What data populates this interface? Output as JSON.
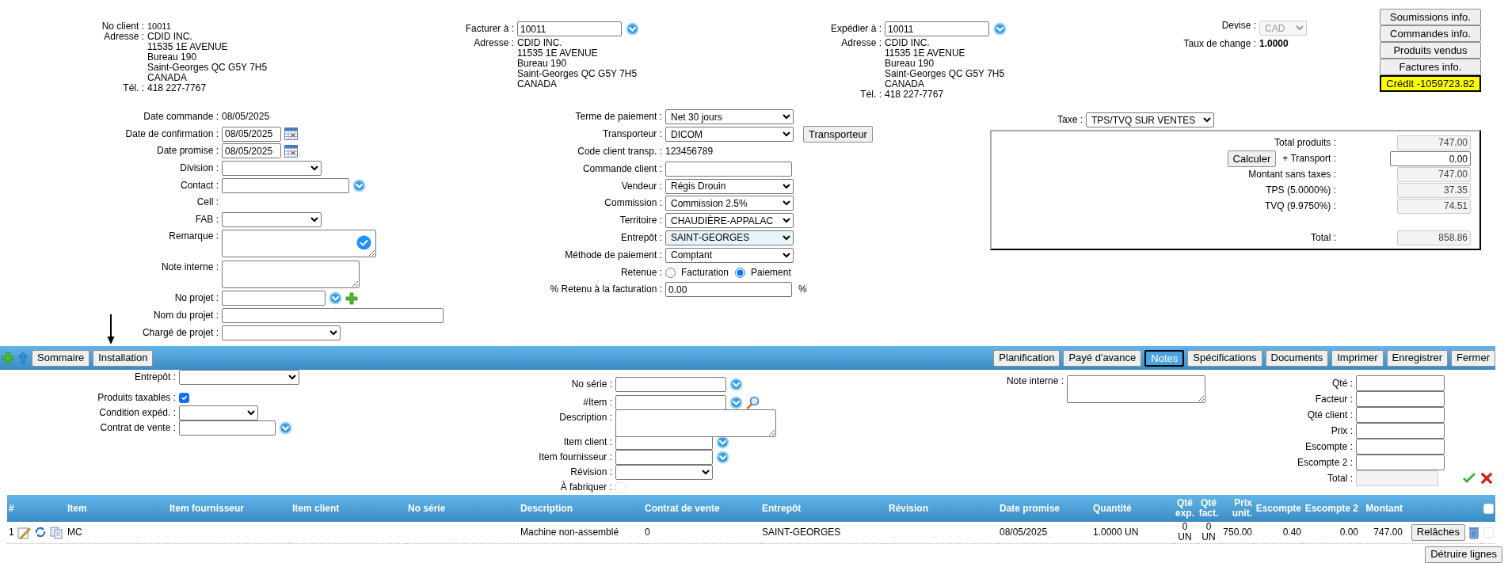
{
  "client": {
    "label": "No client :",
    "value": "10011",
    "address_label": "Adresse :",
    "address_lines": [
      "CDID INC.",
      "11535 1E AVENUE",
      "Bureau 190",
      "Saint-Georges QC G5Y 7H5",
      "CANADA"
    ],
    "phone_label": "Tél. :",
    "phone": "418 227-7767"
  },
  "bill_to": {
    "label": "Facturer à :",
    "value": "10011",
    "address_label": "Adresse :",
    "address_lines": [
      "CDID INC.",
      "11535 1E AVENUE",
      "Bureau 190",
      "Saint-Georges QC G5Y 7H5",
      "CANADA"
    ]
  },
  "ship_to": {
    "label": "Expédier à :",
    "value": "10011",
    "address_label": "Adresse :",
    "address_lines": [
      "CDID INC.",
      "11535 1E AVENUE",
      "Bureau 190",
      "Saint-Georges QC G5Y 7H5",
      "CANADA"
    ],
    "phone_label": "Tél. :",
    "phone": "418 227-7767"
  },
  "currency": {
    "label": "Devise :",
    "value": "CAD",
    "disabled": true,
    "rate_label": "Taux de change :",
    "rate": "1.0000"
  },
  "info_buttons": [
    {
      "label": "Soumissions info.",
      "kind": "button"
    },
    {
      "label": "Commandes info.",
      "kind": "button"
    },
    {
      "label": "Produits vendus",
      "kind": "button"
    },
    {
      "label": "Factures info.",
      "kind": "button"
    },
    {
      "label": "Crédit -1059723.82",
      "kind": "credit"
    }
  ],
  "order_left": [
    {
      "kind": "text",
      "label": "Date commande :",
      "value": "08/05/2025"
    },
    {
      "kind": "date",
      "label": "Date de confirmation :",
      "value": "08/05/2025"
    },
    {
      "kind": "date",
      "label": "Date promise :",
      "value": "08/05/2025"
    },
    {
      "kind": "select",
      "label": "Division :"
    },
    {
      "kind": "lookup",
      "label": "Contact :"
    },
    {
      "kind": "text",
      "label": "Cell :"
    },
    {
      "kind": "select",
      "label": "FAB :"
    },
    {
      "kind": "textarea",
      "label": "Remarque :",
      "assistant": true
    },
    {
      "kind": "textarea",
      "label": "Note interne :",
      "assistant": false
    },
    {
      "kind": "lookup_add",
      "label": "No projet :"
    },
    {
      "kind": "wide_input",
      "label": "Nom du projet :"
    },
    {
      "kind": "select",
      "label": "Chargé de projet :"
    }
  ],
  "order_middle": [
    {
      "kind": "select",
      "label": "Terme de paiement :",
      "value": "Net 30 jours",
      "highlighted": false
    },
    {
      "kind": "select_button",
      "label": "Transporteur :",
      "value": "DICOM",
      "button": "Transporteur"
    },
    {
      "kind": "text",
      "label": "Code client transp. :",
      "value": "123456789"
    },
    {
      "kind": "input",
      "label": "Commande client :"
    },
    {
      "kind": "select",
      "label": "Vendeur :",
      "value": "Régis Drouin",
      "highlighted": false
    },
    {
      "kind": "select",
      "label": "Commission :",
      "value": "Commission 2.5%",
      "highlighted": false
    },
    {
      "kind": "select",
      "label": "Territoire :",
      "value": "CHAUDIÈRE-APPALAC",
      "highlighted": false
    },
    {
      "kind": "select",
      "label": "Entrepôt :",
      "value": "SAINT-GEORGES",
      "highlighted": true
    },
    {
      "kind": "select",
      "label": "Méthode de paiement :",
      "value": "Comptant",
      "highlighted": false
    },
    {
      "kind": "radio",
      "label": "Retenue :",
      "options": [
        {
          "label": "Facturation",
          "selected": false
        },
        {
          "label": "Paiement",
          "selected": true
        }
      ]
    },
    {
      "kind": "input_suffix",
      "label": "% Retenu à la facturation :",
      "value": "0.00",
      "suffix": "%"
    }
  ],
  "tax": {
    "label": "Taxe :",
    "value": "TPS/TVQ SUR VENTES"
  },
  "totals": [
    {
      "kind": "readonly",
      "label": "Total produits :",
      "value": "747.00"
    },
    {
      "kind": "editable",
      "label": "+ Transport :",
      "value": "0.00",
      "button": "Calculer"
    },
    {
      "kind": "readonly",
      "label": "Montant sans taxes :",
      "value": "747.00"
    },
    {
      "kind": "readonly",
      "label": "TPS (5.0000%) :",
      "value": "37.35"
    },
    {
      "kind": "readonly",
      "label": "TVQ (9.9750%) :",
      "value": "74.51"
    },
    {
      "kind": "total",
      "label": "Total :",
      "value": "858.86"
    }
  ],
  "toolbar": {
    "left_buttons": [
      {
        "label": "Sommaire",
        "selected": false
      },
      {
        "label": "Installation",
        "selected": false
      }
    ],
    "right_buttons": [
      {
        "label": "Planification",
        "selected": false
      },
      {
        "label": "Payé d'avance",
        "selected": false
      },
      {
        "label": "Notes",
        "selected": true
      },
      {
        "label": "Spécifications",
        "selected": false
      },
      {
        "label": "Documents",
        "selected": false
      },
      {
        "label": "Imprimer",
        "selected": false
      },
      {
        "label": "Enregistrer",
        "selected": false
      },
      {
        "label": "Fermer",
        "selected": false
      }
    ]
  },
  "item_left": [
    {
      "kind": "select",
      "label": "Entrepôt :"
    },
    {
      "kind": "checkbox",
      "label": "Produits taxables :",
      "checked": true
    },
    {
      "kind": "small_select",
      "label": "Condition expéd. :"
    },
    {
      "kind": "lookup",
      "label": "Contrat de vente :"
    }
  ],
  "item_middle": [
    {
      "kind": "lookup",
      "label": "No série :"
    },
    {
      "kind": "lookup_search",
      "label": "#Item :"
    },
    {
      "kind": "textarea",
      "label": "Description :",
      "assistant": false
    },
    {
      "kind": "lookup",
      "label": "Item client :"
    },
    {
      "kind": "lookup",
      "label": "Item fournisseur :"
    },
    {
      "kind": "select",
      "label": "Révision :"
    },
    {
      "kind": "checkbox",
      "label": "À fabriquer :",
      "checked": false
    }
  ],
  "item_note": [
    {
      "kind": "textarea",
      "label": "Note interne :",
      "assistant": false
    }
  ],
  "item_right": [
    {
      "kind": "input",
      "label": "Qté :"
    },
    {
      "kind": "input",
      "label": "Facteur :"
    },
    {
      "kind": "input",
      "label": "Qté client :"
    },
    {
      "kind": "input",
      "label": "Prix :"
    },
    {
      "kind": "input",
      "label": "Escompte :"
    },
    {
      "kind": "input",
      "label": "Escompte 2 :"
    },
    {
      "kind": "readonly",
      "label": "Total :"
    }
  ],
  "table": {
    "columns": [
      "#",
      "Item",
      "Item fournisseur",
      "Item client",
      "No série",
      "Description",
      "Contrat de vente",
      "Entrepôt",
      "Révision",
      "Date promise",
      "Quantité",
      "Qté exp.",
      "Qté fact.",
      "Prix unit.",
      "Escompte",
      "Escompte 2",
      "Montant"
    ],
    "select_all": false,
    "rows": [
      {
        "cells": [
          "1",
          "MC",
          null,
          null,
          null,
          "Machine non-assemblé",
          "0",
          "SAINT-GEORGES",
          null,
          "08/05/2025",
          "1.0000 UN",
          "0 UN",
          "0 UN",
          "750.00",
          "0.40",
          "0.00",
          "747.00"
        ],
        "button": "Relâches",
        "checked": false
      }
    ]
  },
  "delete_button": "Détruire lignes"
}
